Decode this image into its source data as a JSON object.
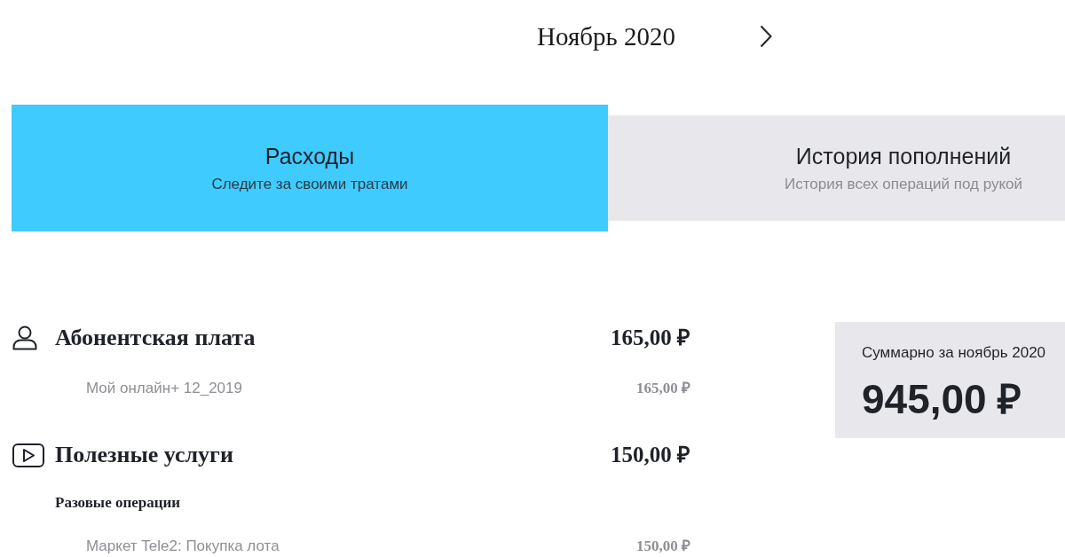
{
  "period": {
    "title": "Ноябрь 2020"
  },
  "tabs": [
    {
      "title": "Расходы",
      "subtitle": "Следите за своими тратами",
      "selected": true
    },
    {
      "title": "История пополнений",
      "subtitle": "История всех операций под рукой",
      "selected": false
    }
  ],
  "categories": [
    {
      "kind": "subscription",
      "title": "Абонентская плата",
      "amount": "165,00 ₽",
      "groups": [
        {
          "items": [
            {
              "name": "Мой онлайн+ 12_2019",
              "amount": "165,00 ₽"
            }
          ]
        }
      ]
    },
    {
      "kind": "services",
      "title": "Полезные услуги",
      "amount": "150,00 ₽",
      "groups": [
        {
          "label": "Разовые операции",
          "items": [
            {
              "name": "Маркет Tele2: Покупка лота",
              "amount": "150,00 ₽"
            }
          ]
        }
      ]
    }
  ],
  "summary": {
    "label": "Суммарно за ноябрь 2020",
    "total": "945,00 ₽"
  }
}
